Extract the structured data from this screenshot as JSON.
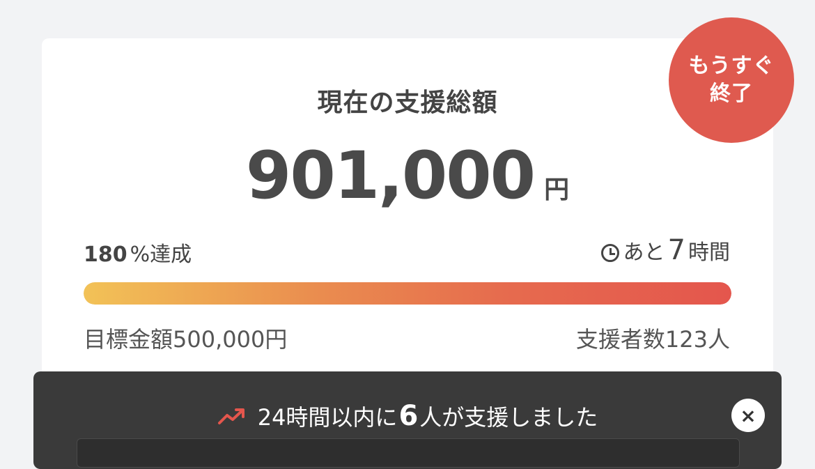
{
  "badge": {
    "line1": "もうすぐ",
    "line2": "終了"
  },
  "title": "現在の支援総額",
  "amount": {
    "value": "901,000",
    "unit": "円"
  },
  "progress": {
    "percent_value": "180",
    "percent_symbol": "%",
    "percent_suffix": "達成",
    "fill_fraction": 1.0,
    "gradient_start": "#f2c257",
    "gradient_end": "#e4564d"
  },
  "remaining": {
    "prefix": "あと",
    "value": "7",
    "suffix": "時間",
    "icon": "clock-icon"
  },
  "goal": {
    "label": "目標金額",
    "value": "500,000円"
  },
  "backers": {
    "label": "支援者数",
    "value": "123",
    "suffix": "人"
  },
  "toast": {
    "icon": "trending-up-icon",
    "prefix": "24時間以内に",
    "count": "6",
    "suffix": "人が支援しました",
    "close_icon": "close-icon"
  },
  "colors": {
    "accent": "#df5a4f",
    "toast_bg": "#3a3a3a",
    "text": "#444444"
  }
}
